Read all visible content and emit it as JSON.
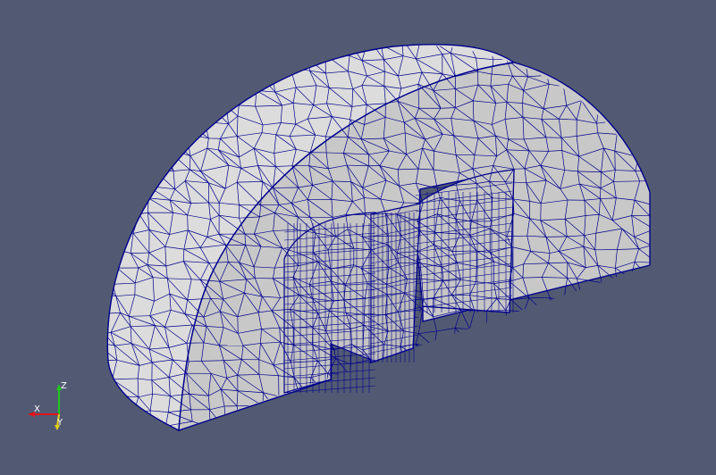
{
  "viewport": {
    "background_color": "#525a73",
    "mesh": {
      "surface_color": "#c8c8c8",
      "outer_surface_color": "#dcdcdc",
      "wire_color": "#00008c"
    }
  },
  "orientation_axes": {
    "x_label": "X",
    "y_label": "Y",
    "z_label": "Z",
    "x_color": "#e0151b",
    "y_color": "#e6d21a",
    "z_color": "#1ec81e"
  }
}
